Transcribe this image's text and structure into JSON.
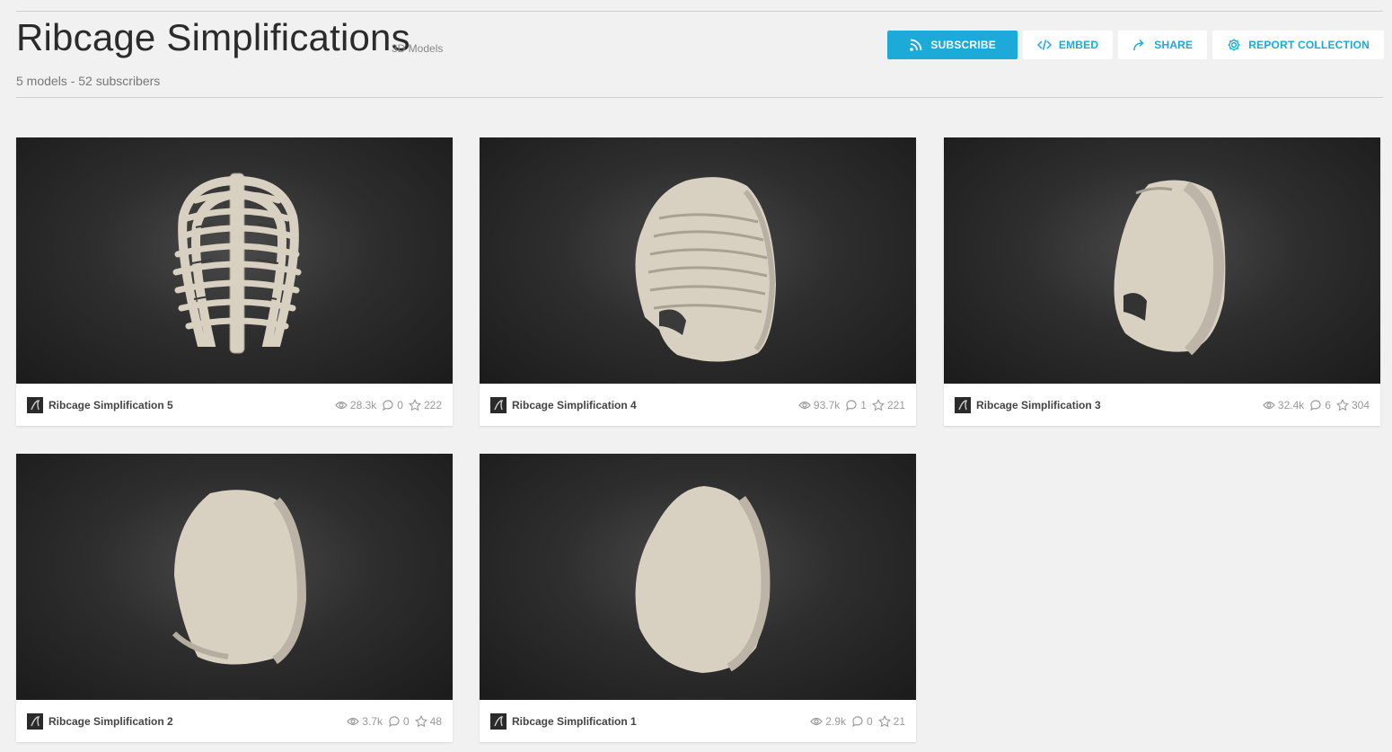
{
  "header": {
    "title": "Ribcage Simplifications",
    "type_label": "3D Models",
    "meta": "5 models - 52 subscribers"
  },
  "actions": [
    {
      "label": "SUBSCRIBE",
      "icon": "rss-icon"
    },
    {
      "label": "EMBED",
      "icon": "code-icon"
    },
    {
      "label": "SHARE",
      "icon": "share-icon"
    },
    {
      "label": "REPORT COLLECTION",
      "icon": "gear-icon"
    }
  ],
  "models": [
    {
      "name": "Ribcage Simplification 5",
      "views": "28.3k",
      "comments": "0",
      "likes": "222",
      "shape": "ribcage-detailed"
    },
    {
      "name": "Ribcage Simplification 4",
      "views": "93.7k",
      "comments": "1",
      "likes": "221",
      "shape": "ribcage-smoothed"
    },
    {
      "name": "Ribcage Simplification 3",
      "views": "32.4k",
      "comments": "6",
      "likes": "304",
      "shape": "ribcage-planar"
    },
    {
      "name": "Ribcage Simplification 2",
      "views": "3.7k",
      "comments": "0",
      "likes": "48",
      "shape": "ribcage-blocky"
    },
    {
      "name": "Ribcage Simplification 1",
      "views": "2.9k",
      "comments": "0",
      "likes": "21",
      "shape": "ribcage-egg"
    }
  ],
  "colors": {
    "accent": "#1caad9",
    "model_fill": "#d8d0c0",
    "background": "#f1f1f1"
  }
}
